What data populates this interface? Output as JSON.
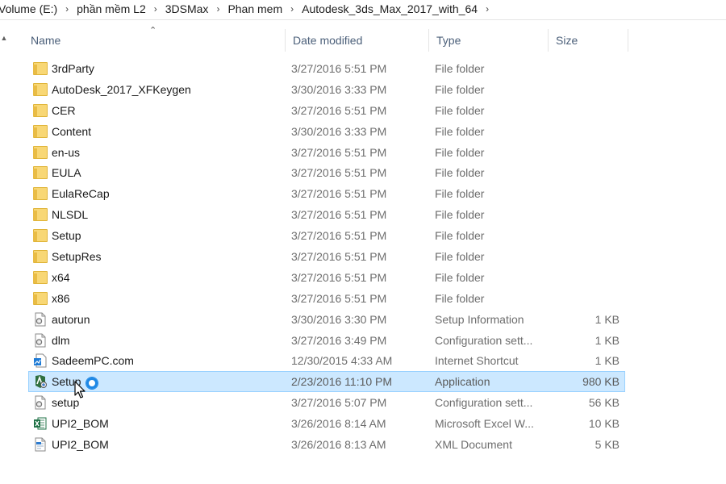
{
  "breadcrumb": [
    "Volume (E:)",
    "phần mềm L2",
    "3DSMax",
    "Phan mem",
    "Autodesk_3ds_Max_2017_with_64"
  ],
  "columns": {
    "name": "Name",
    "date": "Date modified",
    "type": "Type",
    "size": "Size"
  },
  "files": [
    {
      "name": "3rdParty",
      "date": "3/27/2016 5:51 PM",
      "type": "File folder",
      "size": "",
      "icon": "folder-icon"
    },
    {
      "name": "AutoDesk_2017_XFKeygen",
      "date": "3/30/2016 3:33 PM",
      "type": "File folder",
      "size": "",
      "icon": "folder-icon"
    },
    {
      "name": "CER",
      "date": "3/27/2016 5:51 PM",
      "type": "File folder",
      "size": "",
      "icon": "folder-icon"
    },
    {
      "name": "Content",
      "date": "3/30/2016 3:33 PM",
      "type": "File folder",
      "size": "",
      "icon": "folder-icon"
    },
    {
      "name": "en-us",
      "date": "3/27/2016 5:51 PM",
      "type": "File folder",
      "size": "",
      "icon": "folder-icon"
    },
    {
      "name": "EULA",
      "date": "3/27/2016 5:51 PM",
      "type": "File folder",
      "size": "",
      "icon": "folder-icon"
    },
    {
      "name": "EulaReCap",
      "date": "3/27/2016 5:51 PM",
      "type": "File folder",
      "size": "",
      "icon": "folder-icon"
    },
    {
      "name": "NLSDL",
      "date": "3/27/2016 5:51 PM",
      "type": "File folder",
      "size": "",
      "icon": "folder-icon"
    },
    {
      "name": "Setup",
      "date": "3/27/2016 5:51 PM",
      "type": "File folder",
      "size": "",
      "icon": "folder-icon"
    },
    {
      "name": "SetupRes",
      "date": "3/27/2016 5:51 PM",
      "type": "File folder",
      "size": "",
      "icon": "folder-icon"
    },
    {
      "name": "x64",
      "date": "3/27/2016 5:51 PM",
      "type": "File folder",
      "size": "",
      "icon": "folder-icon"
    },
    {
      "name": "x86",
      "date": "3/27/2016 5:51 PM",
      "type": "File folder",
      "size": "",
      "icon": "folder-icon"
    },
    {
      "name": "autorun",
      "date": "3/30/2016 3:30 PM",
      "type": "Setup Information",
      "size": "1 KB",
      "icon": "settings-file-icon"
    },
    {
      "name": "dlm",
      "date": "3/27/2016 3:49 PM",
      "type": "Configuration sett...",
      "size": "1 KB",
      "icon": "settings-file-icon"
    },
    {
      "name": "SadeemPC.com",
      "date": "12/30/2015 4:33 AM",
      "type": "Internet Shortcut",
      "size": "1 KB",
      "icon": "internet-shortcut-icon"
    },
    {
      "name": "Setup",
      "date": "2/23/2016 11:10 PM",
      "type": "Application",
      "size": "980 KB",
      "icon": "application-icon",
      "selected": true
    },
    {
      "name": "setup",
      "date": "3/27/2016 5:07 PM",
      "type": "Configuration sett...",
      "size": "56 KB",
      "icon": "settings-file-icon"
    },
    {
      "name": "UPI2_BOM",
      "date": "3/26/2016 8:14 AM",
      "type": "Microsoft Excel W...",
      "size": "10 KB",
      "icon": "excel-file-icon"
    },
    {
      "name": "UPI2_BOM",
      "date": "3/26/2016 8:13 AM",
      "type": "XML Document",
      "size": "5 KB",
      "icon": "xml-file-icon"
    }
  ],
  "colors": {
    "selection": "#cce8ff",
    "selection_border": "#99d1ff",
    "folder": "#f8d775",
    "header_text": "#4c607a",
    "secondary_text": "#6d6d6d"
  }
}
